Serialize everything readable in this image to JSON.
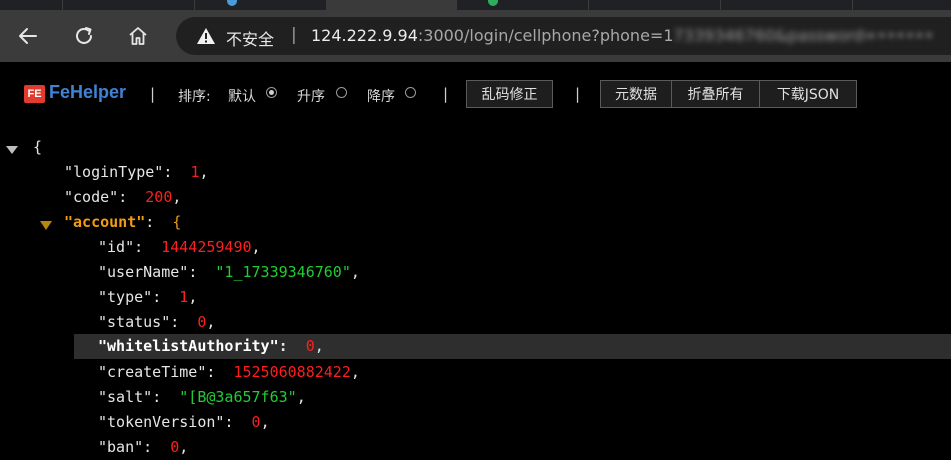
{
  "browser": {
    "security_label": "不安全",
    "url_host": "124.222.9.94",
    "url_path": ":3000/login/cellphone?phone=1",
    "url_obscured": "7339346760&password=",
    "url_obscured_tail": "••••••"
  },
  "fehelper": {
    "title": "FeHelper",
    "sort_label": "排序:",
    "sort_default": "默认",
    "sort_asc": "升序",
    "sort_desc": "降序",
    "fix_encoding_button": "乱码修正",
    "metadata_button": "元数据",
    "collapse_all_button": "折叠所有",
    "download_json_button": "下载JSON"
  },
  "json": {
    "open_brace": "{",
    "loginType_key": "\"loginType\"",
    "loginType_value": "1",
    "code_key": "\"code\"",
    "code_value": "200",
    "account_key": "\"account\"",
    "account_open": "{",
    "id_key": "\"id\"",
    "id_value": "1444259490",
    "userName_key": "\"userName\"",
    "userName_value": "\"1_17339346760\"",
    "type_key": "\"type\"",
    "type_value": "1",
    "status_key": "\"status\"",
    "status_value": "0",
    "whitelistAuthority_key": "\"whitelistAuthority\"",
    "whitelistAuthority_value": "0",
    "createTime_key": "\"createTime\"",
    "createTime_value": "1525060882422",
    "salt_key": "\"salt\"",
    "salt_value": "\"[B@3a657f63\"",
    "tokenVersion_key": "\"tokenVersion\"",
    "tokenVersion_value": "0",
    "ban_key": "\"ban\"",
    "ban_value": "0"
  },
  "colors": {
    "number": "#ff1e1e",
    "string": "#22cc33",
    "highlight_key": "#f39c12",
    "brand": "#3f82d6"
  }
}
